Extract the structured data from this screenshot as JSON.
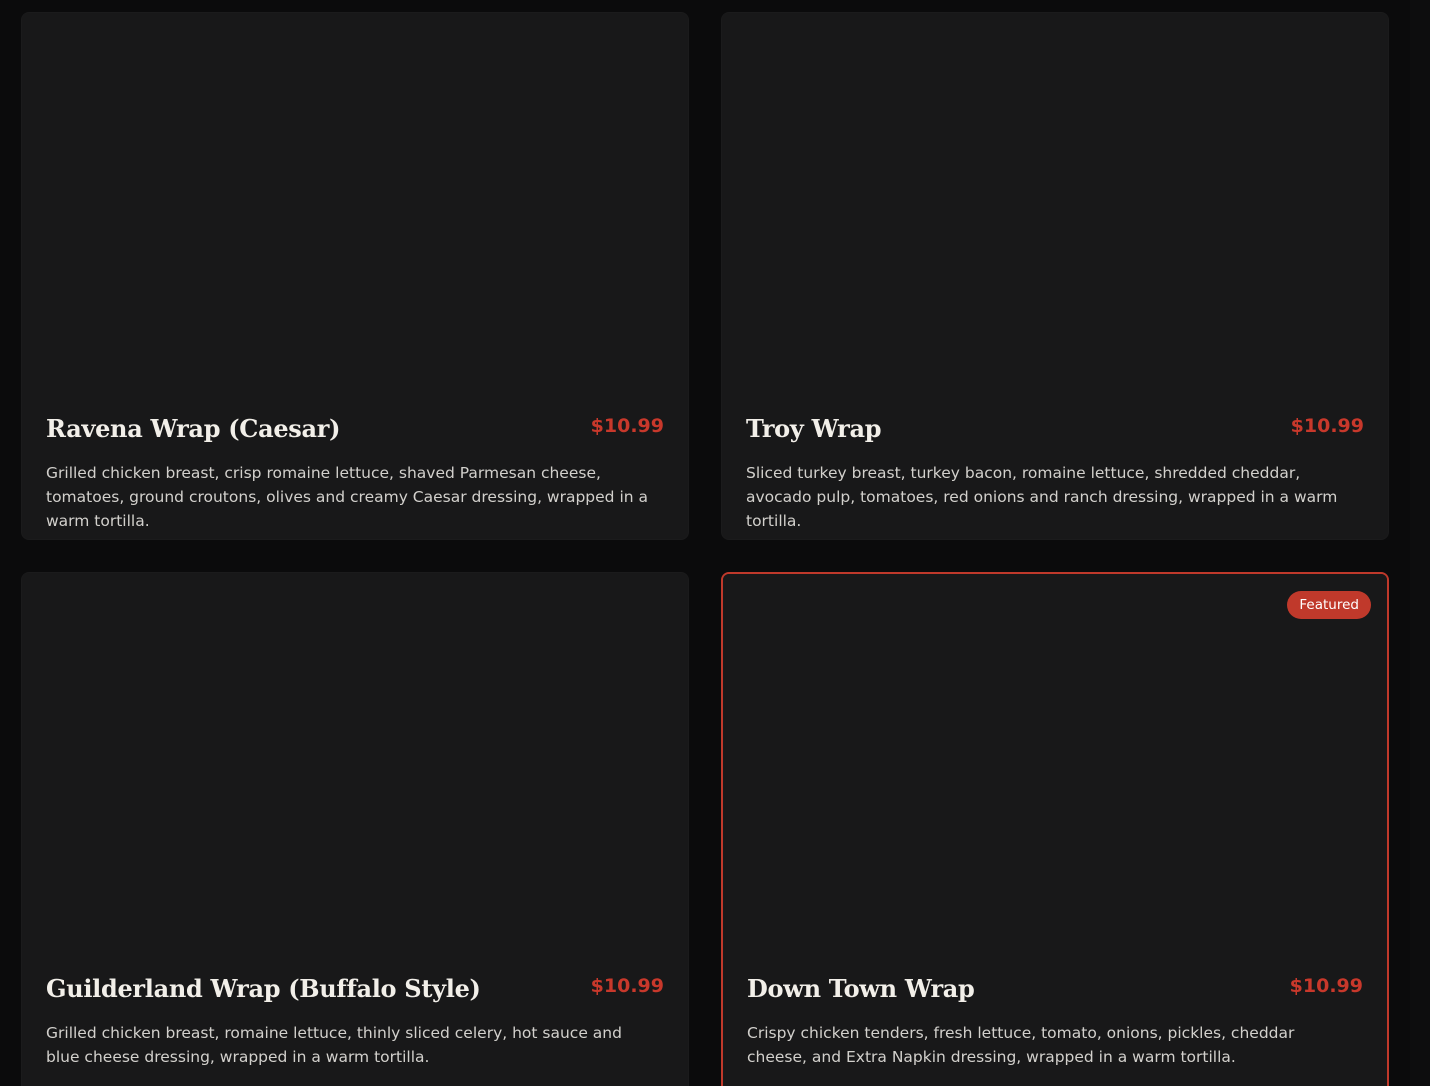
{
  "menu": {
    "items": [
      {
        "name": "Ravena Wrap (Caesar)",
        "price": "$10.99",
        "description": "Grilled chicken breast, crisp romaine lettuce, shaved Parmesan cheese, tomatoes, ground croutons, olives and creamy Caesar dressing, wrapped in a warm tortilla."
      },
      {
        "name": "Troy Wrap",
        "price": "$10.99",
        "description": "Sliced turkey breast, turkey bacon, romaine lettuce, shredded cheddar, avocado pulp, tomatoes, red onions and ranch dressing, wrapped in a warm tortilla."
      },
      {
        "name": "Guilderland Wrap (Buffalo Style)",
        "price": "$10.99",
        "description": "Grilled chicken breast, romaine lettuce, thinly sliced celery, hot sauce and blue cheese dressing, wrapped in a warm tortilla."
      },
      {
        "name": "Down Town Wrap",
        "price": "$10.99",
        "description": "Crispy chicken tenders, fresh lettuce, tomato, onions, pickles, cheddar cheese, and Extra Napkin dressing, wrapped in a warm tortilla.",
        "badge": "Featured"
      }
    ]
  },
  "colors": {
    "background": "#0b0b0c",
    "card": "#181819",
    "accent": "#c0392b",
    "price": "#c8382b",
    "title": "#f2efe9",
    "text": "#d2d0cc"
  }
}
